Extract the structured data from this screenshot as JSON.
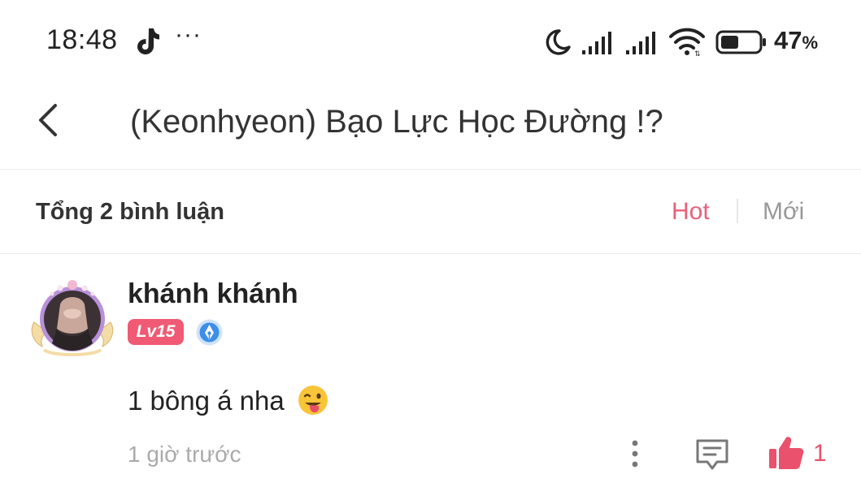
{
  "status_bar": {
    "time": "18:48",
    "dots": "···",
    "battery_percent": "47",
    "battery_unit": "%",
    "battery_level": 0.47,
    "icons": [
      "tiktok-icon",
      "moon-icon",
      "signal-icon",
      "signal-icon",
      "wifi-icon",
      "battery-icon"
    ]
  },
  "header": {
    "title": "(Keonhyeon) Bạo Lực Học Đường !?",
    "back_icon": "chevron-left-icon"
  },
  "comments_header": {
    "total": "Tổng 2 bình luận",
    "sort_hot": "Hot",
    "sort_new": "Mới",
    "active_sort": "Hot"
  },
  "comment": {
    "username": "khánh khánh",
    "level_badge": "Lv15",
    "text": "1 bông á nha",
    "emoji": "winking-face-with-tongue",
    "timestamp": "1 giờ trước",
    "like_count": "1"
  },
  "colors": {
    "accent": "#e9607a",
    "level_badge": "#f05a74",
    "like": "#e9516d",
    "muted_text": "#999999"
  }
}
